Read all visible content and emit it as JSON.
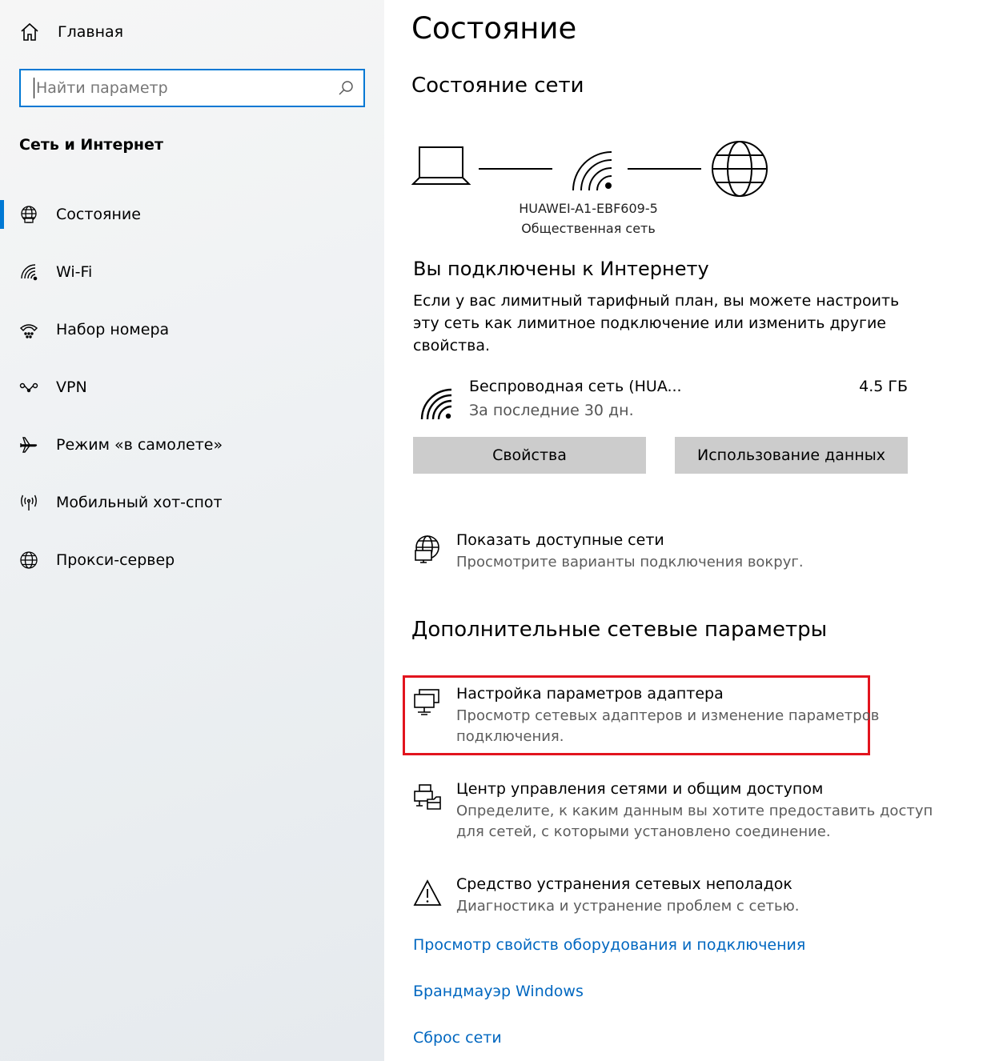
{
  "sidebar": {
    "home_label": "Главная",
    "search": {
      "value": "",
      "placeholder": "Найти параметр"
    },
    "section_title": "Сеть и Интернет",
    "items": [
      {
        "label": "Состояние",
        "icon": "globe-status-icon",
        "active": true
      },
      {
        "label": "Wi-Fi",
        "icon": "wifi-icon"
      },
      {
        "label": "Набор номера",
        "icon": "dialup-icon"
      },
      {
        "label": "VPN",
        "icon": "vpn-icon"
      },
      {
        "label": "Режим «в самолете»",
        "icon": "airplane-icon"
      },
      {
        "label": "Мобильный хот-спот",
        "icon": "hotspot-icon"
      },
      {
        "label": "Прокси-сервер",
        "icon": "globe-icon"
      }
    ]
  },
  "main": {
    "title": "Состояние",
    "network_status_heading": "Состояние сети",
    "network": {
      "ssid": "HUAWEI-A1-EBF609-5",
      "type": "Общественная сеть"
    },
    "connected_title": "Вы подключены к Интернету",
    "connected_desc": "Если у вас лимитный тарифный план, вы можете настроить эту сеть как лимитное подключение или изменить другие свойства.",
    "connection": {
      "name": "Беспроводная сеть (HUA...",
      "period": "За последние 30 дн.",
      "usage": "4.5 ГБ"
    },
    "buttons": {
      "properties": "Свойства",
      "data_usage": "Использование данных"
    },
    "show_networks": {
      "title": "Показать доступные сети",
      "desc": "Просмотрите варианты подключения вокруг."
    },
    "advanced_heading": "Дополнительные сетевые параметры",
    "adapter": {
      "title": "Настройка параметров адаптера",
      "desc": "Просмотр сетевых адаптеров и изменение параметров подключения."
    },
    "sharing_center": {
      "title": "Центр управления сетями и общим доступом",
      "desc": "Определите, к каким данным вы хотите предоставить доступ для сетей, с которыми установлено соединение."
    },
    "troubleshoot": {
      "title": "Средство устранения сетевых неполадок",
      "desc": "Диагностика и устранение проблем с сетью."
    },
    "links": {
      "hardware": "Просмотр свойств оборудования и подключения",
      "firewall": "Брандмауэр Windows",
      "reset": "Сброс сети"
    }
  },
  "colors": {
    "accent": "#0078d4",
    "link": "#0067c0",
    "highlight": "#e2141e",
    "button": "#cccccc"
  }
}
